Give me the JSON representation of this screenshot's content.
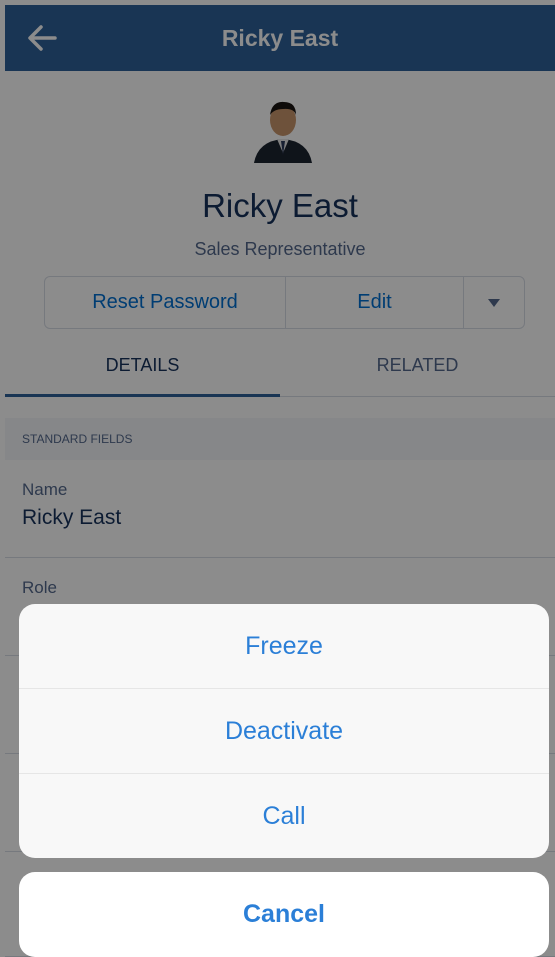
{
  "header": {
    "title": "Ricky East",
    "back_icon": "arrow-left-icon"
  },
  "profile": {
    "name": "Ricky East",
    "subtitle": "Sales Representative",
    "avatar": "user-photo"
  },
  "actions": {
    "reset_label": "Reset Password",
    "edit_label": "Edit",
    "more_icon": "caret-down-icon"
  },
  "tabs": [
    {
      "label": "DETAILS",
      "active": true
    },
    {
      "label": "RELATED",
      "active": false
    }
  ],
  "section": {
    "title": "STANDARD FIELDS"
  },
  "fields": [
    {
      "label": "Name",
      "value": "Ricky East"
    },
    {
      "label": "Role",
      "value": ""
    }
  ],
  "action_sheet": {
    "items": [
      {
        "label": "Freeze"
      },
      {
        "label": "Deactivate"
      },
      {
        "label": "Call"
      }
    ],
    "cancel_label": "Cancel"
  },
  "colors": {
    "header": "#2e6299",
    "accent": "#0070d2",
    "ios_blue": "#2b7fd7"
  }
}
